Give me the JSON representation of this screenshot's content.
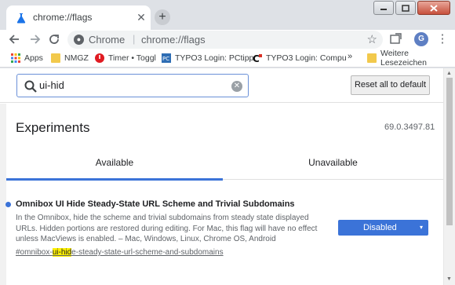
{
  "window": {
    "tab_title": "chrome://flags",
    "new_tab_symbol": "+",
    "close_symbol": "✕"
  },
  "toolbar": {
    "omnibox_scheme": "Chrome",
    "omnibox_separator": "|",
    "omnibox_url": "chrome://flags",
    "avatar_initial": "G"
  },
  "bookmarks": {
    "items": [
      {
        "label": "Apps",
        "icon": "apps-grid-icon"
      },
      {
        "label": "NMGZ",
        "icon": "folder-icon"
      },
      {
        "label": "Timer • Toggl",
        "icon": "toggl-icon"
      },
      {
        "label": "TYPO3 Login: PCtipp",
        "icon": "pctipp-icon"
      },
      {
        "label": "TYPO3 Login: Compu",
        "icon": "computerworld-icon"
      }
    ],
    "more_symbol": "»",
    "other_label": "Weitere Lesezeichen"
  },
  "search": {
    "value": "ui-hid",
    "reset_label": "Reset all to default"
  },
  "experiments": {
    "title": "Experiments",
    "version": "69.0.3497.81",
    "tab_available": "Available",
    "tab_unavailable": "Unavailable"
  },
  "flag": {
    "title": "Omnibox UI Hide Steady-State URL Scheme and Trivial Subdomains",
    "description": "In the Omnibox, hide the scheme and trivial subdomains from steady state displayed URLs. Hidden portions are restored during editing. For Mac, this flag will have no effect unless MacViews is enabled. – Mac, Windows, Linux, Chrome OS, Android",
    "link_prefix": "#omnibox-",
    "link_highlight": "ui-hid",
    "link_suffix": "e-steady-state-url-scheme-and-subdomains",
    "select_value": "Disabled",
    "select_arrow": "▾"
  },
  "colors": {
    "accent": "#3b73d8",
    "highlight": "#fff100"
  }
}
